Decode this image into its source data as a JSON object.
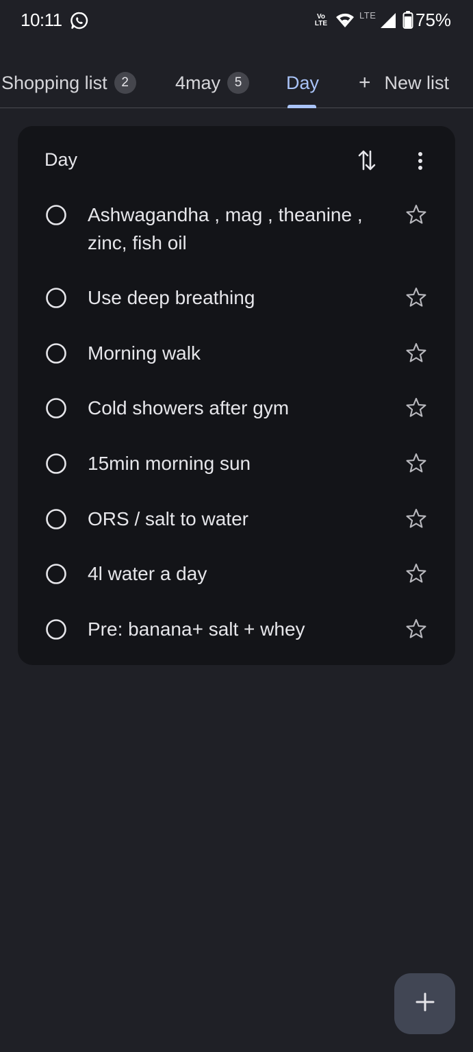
{
  "status_bar": {
    "time": "10:11",
    "volte_line1": "Vo",
    "volte_line2": "LTE",
    "network": "LTE",
    "battery": "75%",
    "icons": [
      "whatsapp-icon",
      "volte-icon",
      "wifi-icon",
      "signal-icon",
      "battery-icon"
    ]
  },
  "tabs": [
    {
      "label": "Shopping list",
      "count": "2"
    },
    {
      "label": "4may",
      "count": "5"
    },
    {
      "label": "Day",
      "active": true
    },
    {
      "label": "New list",
      "icon": "plus-icon"
    }
  ],
  "list": {
    "title": "Day",
    "tasks": [
      {
        "text": "Ashwagandha , mag , theanine  , zinc, fish oil",
        "starred": false
      },
      {
        "text": "Use deep breathing",
        "starred": false
      },
      {
        "text": "Morning walk",
        "starred": false
      },
      {
        "text": "Cold showers after gym",
        "starred": false
      },
      {
        "text": "15min morning sun",
        "starred": false
      },
      {
        "text": "ORS / salt to water",
        "starred": false
      },
      {
        "text": "4l water a day",
        "starred": false
      },
      {
        "text": "Pre: banana+ salt + whey",
        "starred": false
      }
    ]
  },
  "colors": {
    "background": "#1f2026",
    "card": "#131418",
    "accent": "#a9c3f7",
    "fab": "#414654"
  }
}
